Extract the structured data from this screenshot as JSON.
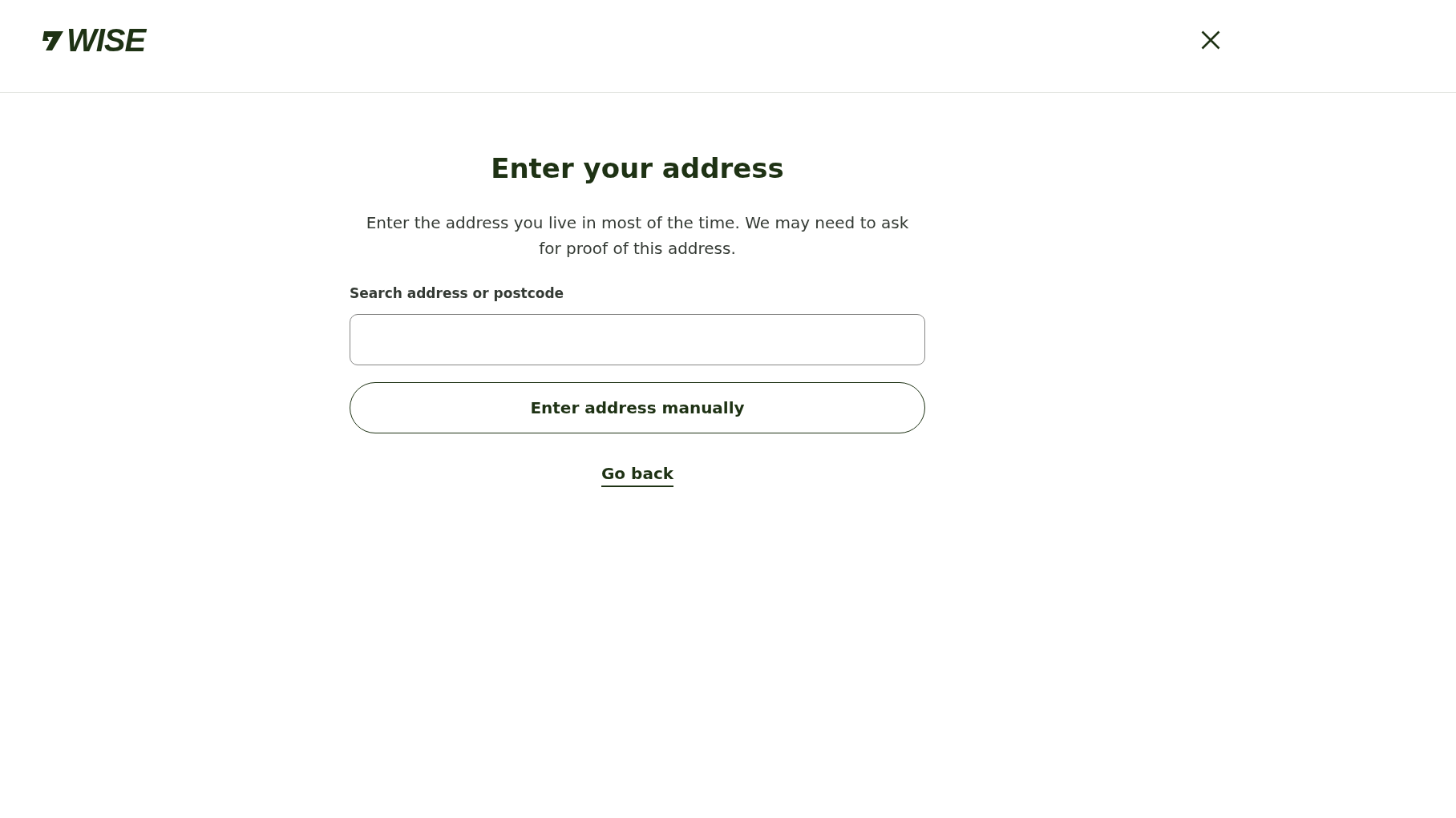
{
  "header": {
    "logo_text": "WISE"
  },
  "title": "Enter your address",
  "description": "Enter the address you live in most of the time. We may need to ask for proof of this address.",
  "search": {
    "label": "Search address or postcode"
  },
  "buttons": [
    {
      "label": "Enter address manually",
      "kind": "outline"
    },
    {
      "label": "Go back",
      "kind": "link"
    }
  ]
}
